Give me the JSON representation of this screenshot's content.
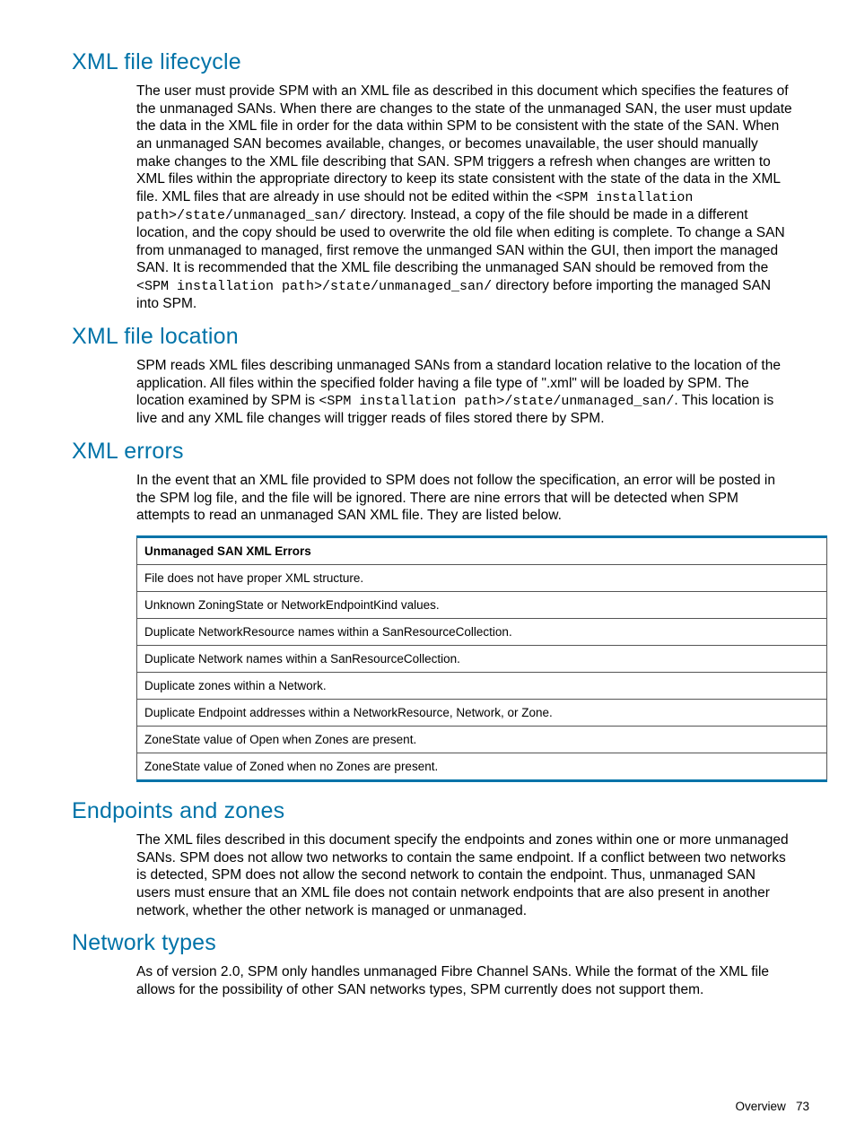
{
  "sections": {
    "lifecycle": {
      "heading": "XML file lifecycle",
      "p1a": "The user must provide SPM with an XML file as described in this document which specifies the features of the unmanaged SANs. When there are changes to the state of the unmanaged SAN, the user must update the data in the XML file in order for the data within SPM to be consistent with the state of the SAN. When an unmanaged SAN becomes available, changes, or becomes unavailable, the user should manually make changes to the XML file describing that SAN. SPM triggers a refresh when changes are written to XML files within the appropriate directory to keep its state consistent with the state of the data in the XML file. XML files that are already in use should not be edited within the ",
      "code1": "<SPM installation path>/state/unmanaged_san/",
      "p1b": " directory. Instead, a copy of the file should be made in a different location, and the copy should be used to overwrite the old file when editing is complete. To change a SAN from unmanaged to managed, first remove the unmanged SAN within the GUI, then import the managed SAN. It is recommended that the XML file describing the unmanaged SAN should be removed from the ",
      "code2": "<SPM installation path>/state/unmanaged_san/",
      "p1c": " directory before importing the managed SAN into SPM."
    },
    "location": {
      "heading": "XML file location",
      "p1a": "SPM reads XML files describing unmanaged SANs from a standard location relative to the location of the application. All files within the specified folder having a file type of \".xml\" will be loaded by SPM. The location examined by SPM is ",
      "code1": "<SPM installation path>/state/unmanaged_san/",
      "p1b": ". This location is live and any XML file changes will trigger reads of files stored there by SPM."
    },
    "errors": {
      "heading": "XML errors",
      "p1": "In the event that an XML file provided to SPM does not follow the specification, an error will be posted in the SPM log file, and the file will be ignored. There are nine errors that will be detected when SPM attempts to read an unmanaged SAN XML file. They are listed below.",
      "table_header": "Unmanaged SAN XML Errors",
      "rows": [
        "File does not have proper XML structure.",
        "Unknown ZoningState or NetworkEndpointKind values.",
        "Duplicate NetworkResource names within a SanResourceCollection.",
        "Duplicate Network names within a SanResourceCollection.",
        "Duplicate zones within a Network.",
        "Duplicate Endpoint addresses within a NetworkResource, Network, or Zone.",
        "ZoneState value of Open when Zones are present.",
        "ZoneState value of Zoned when no Zones are present."
      ]
    },
    "endpoints": {
      "heading": "Endpoints and zones",
      "p1": "The XML files described in this document specify the endpoints and zones within one or more unmanaged SANs. SPM does not allow two networks to contain the same endpoint. If a conflict between two networks is detected, SPM does not allow the second network to contain the endpoint. Thus, unmanaged SAN users must ensure that an XML file does not contain network endpoints that are also present in another network, whether the other network is managed or unmanaged."
    },
    "network": {
      "heading": "Network types",
      "p1": "As of version 2.0, SPM only handles unmanaged Fibre Channel SANs. While the format of the XML file allows for the possibility of other SAN networks types, SPM currently does not support them."
    }
  },
  "footer": {
    "label": "Overview",
    "page": "73"
  }
}
